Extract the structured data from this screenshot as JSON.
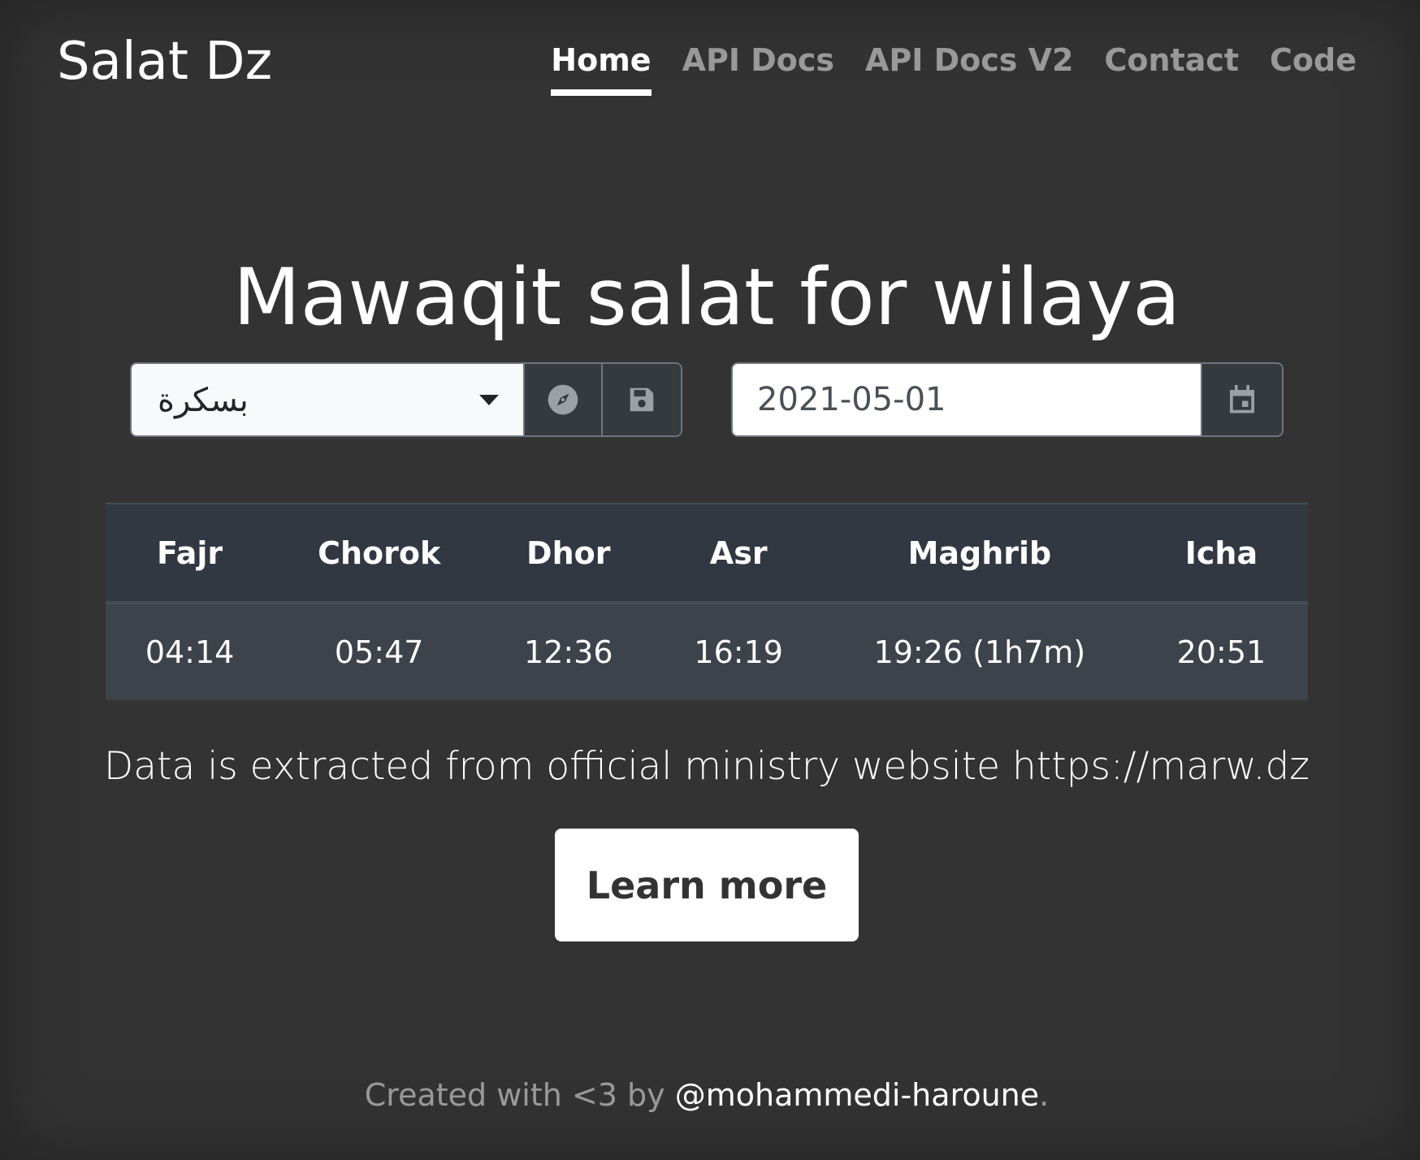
{
  "brand": "Salat Dz",
  "nav": {
    "items": [
      {
        "label": "Home"
      },
      {
        "label": "API Docs"
      },
      {
        "label": "API Docs V2"
      },
      {
        "label": "Contact"
      },
      {
        "label": "Code"
      }
    ],
    "active": "Home"
  },
  "title": "Mawaqit salat for wilaya",
  "wilaya_select": {
    "selected": "بسكرة",
    "locate_icon": "compass-icon",
    "save_icon": "save-icon"
  },
  "date": {
    "value": "2021-05-01",
    "calendar_icon": "calendar-icon"
  },
  "prayer_table": {
    "headers": [
      "Fajr",
      "Chorok",
      "Dhor",
      "Asr",
      "Maghrib",
      "Icha"
    ],
    "times": [
      "04:14",
      "05:47",
      "12:36",
      "16:19",
      "19:26 (1h7m)",
      "20:51"
    ]
  },
  "description": "Data is extracted from official ministry website https://marw.dz",
  "learn_more_label": "Learn more",
  "footer": {
    "prefix": "Created with <3 by ",
    "author": "@mohammedi-haroune",
    "suffix": "."
  },
  "colors": {
    "background": "#333333",
    "table_head": "#323842",
    "table_row": "#3d434b",
    "button_dark": "#343a40"
  }
}
